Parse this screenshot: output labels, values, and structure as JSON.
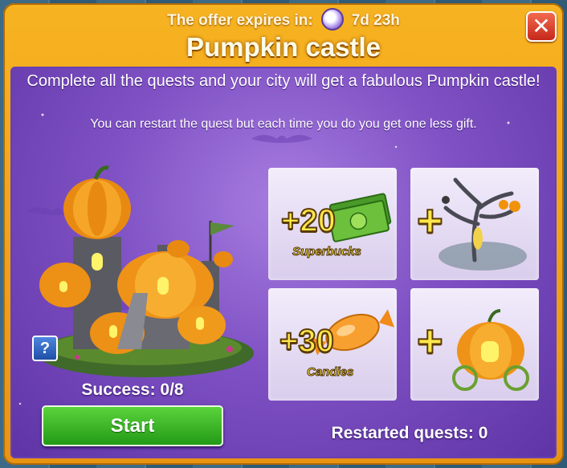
{
  "header": {
    "expires_label": "The offer expires in:",
    "timer_icon": "clock-icon",
    "expires_value": "7d 23h",
    "title": "Pumpkin castle",
    "close_icon": "close-icon",
    "close_glyph": "✕"
  },
  "description": {
    "main": "Complete all the quests and your city will get a fabulous Pumpkin castle!",
    "sub": "You can restart the quest but each time you do you get one less gift."
  },
  "quest": {
    "image": "pumpkin-castle-building",
    "help_label": "?",
    "success_label": "Success: 0/8",
    "start_label": "Start",
    "restarted_label": "Restarted quests: 0"
  },
  "rewards": [
    {
      "type": "currency",
      "amount": "+20",
      "label": "Superbucks",
      "icon": "superbucks-icon"
    },
    {
      "type": "item",
      "amount": "+",
      "icon": "spooky-tree-icon"
    },
    {
      "type": "currency",
      "amount": "+30",
      "label": "Candies",
      "icon": "candy-icon"
    },
    {
      "type": "item",
      "amount": "+",
      "icon": "pumpkin-carriage-icon"
    }
  ],
  "colors": {
    "frame": "#f0a51a",
    "panel": "#7f51c4",
    "start_button": "#3bb524",
    "close_button": "#d9382a",
    "reward_text": "#ffe84a"
  }
}
